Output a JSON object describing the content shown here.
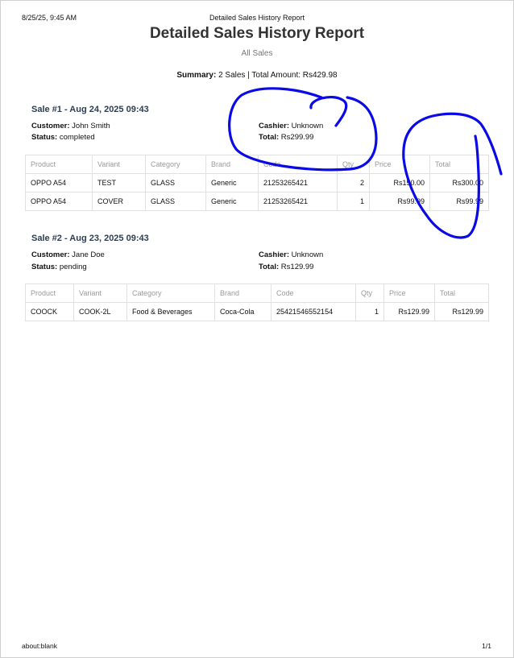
{
  "header": {
    "print_datetime": "8/25/25, 9:45 AM",
    "print_title": "Detailed Sales History Report"
  },
  "report": {
    "title": "Detailed Sales History Report",
    "subtitle": "All Sales",
    "summary_label": "Summary:",
    "summary_text": "2 Sales | Total Amount: Rs429.98"
  },
  "labels": {
    "customer": "Customer:",
    "cashier": "Cashier:",
    "status": "Status:",
    "total": "Total:"
  },
  "columns": [
    "Product",
    "Variant",
    "Category",
    "Brand",
    "Code",
    "Qty",
    "Price",
    "Total"
  ],
  "sales": [
    {
      "heading": "Sale #1 - Aug 24, 2025 09:43",
      "customer": "John Smith",
      "cashier": "Unknown",
      "status": "completed",
      "total": "Rs299.99",
      "items": [
        [
          "OPPO A54",
          "TEST",
          "GLASS",
          "Generic",
          "21253265421",
          "2",
          "Rs150.00",
          "Rs300.00"
        ],
        [
          "OPPO A54",
          "COVER",
          "GLASS",
          "Generic",
          "21253265421",
          "1",
          "Rs99.99",
          "Rs99.99"
        ]
      ]
    },
    {
      "heading": "Sale #2 - Aug 23, 2025 09:43",
      "customer": "Jane Doe",
      "cashier": "Unknown",
      "status": "pending",
      "total": "Rs129.99",
      "items": [
        [
          "COOCK",
          "COOK-2L",
          "Food & Beverages",
          "Coca-Cola",
          "25421546552154",
          "1",
          "Rs129.99",
          "Rs129.99"
        ]
      ]
    }
  ],
  "footer": {
    "url": "about:blank",
    "page": "1/1"
  },
  "colors": {
    "title": "#333333",
    "sale_heading": "#2c3e50",
    "table_border": "#e0e0e0",
    "annotation_ink": "#0a0ae6"
  }
}
